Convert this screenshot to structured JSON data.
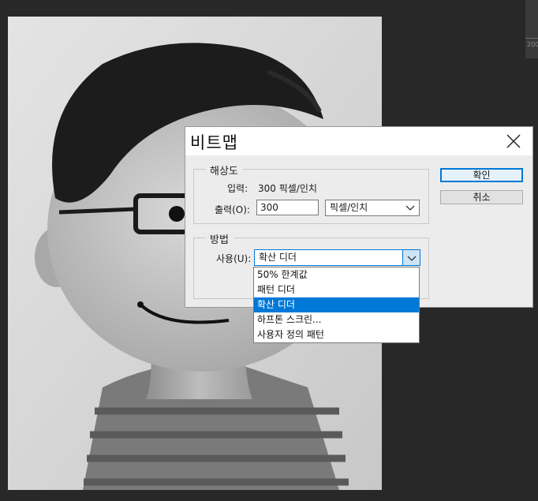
{
  "ruler": {
    "value": "200"
  },
  "dialog": {
    "title": "비트맵",
    "resolution": {
      "legend": "해상도",
      "input_label": "입력:",
      "input_value": "300 픽셀/인치",
      "output_label": "출력(O):",
      "output_value": "300",
      "unit_selected": "픽셀/인치"
    },
    "method": {
      "legend": "방법",
      "use_label": "사용(U):",
      "use_selected": "확산 디더",
      "options": [
        "50% 한계값",
        "패턴 디더",
        "확산 디더",
        "하프톤 스크린...",
        "사용자 정의 패턴"
      ],
      "selected_index": 2
    },
    "buttons": {
      "ok": "확인",
      "cancel": "취소"
    }
  },
  "colors": {
    "accent": "#0078d7",
    "dialog_bg": "#ececec",
    "app_bg": "#282828"
  },
  "icons": {
    "close": "close-icon",
    "dropdown": "chevron-down-icon"
  }
}
